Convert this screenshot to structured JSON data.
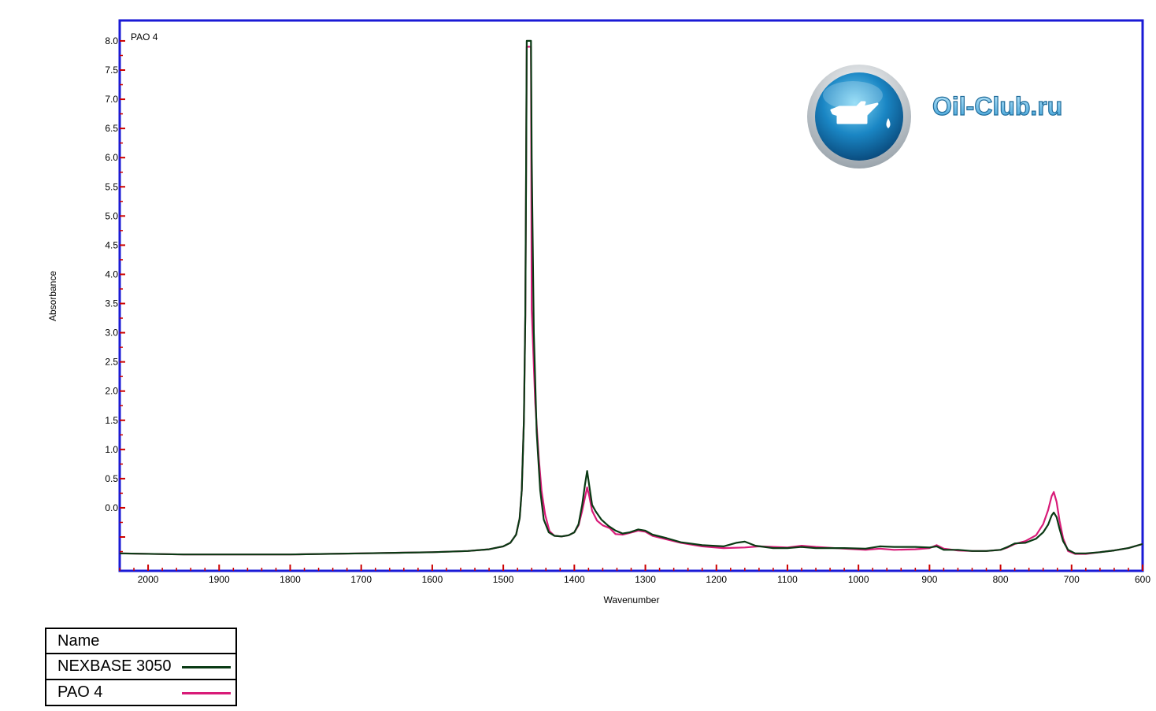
{
  "chart_data": {
    "type": "line",
    "title": "PAO 4",
    "xlabel": "Wavenumber",
    "ylabel": "Absorbance",
    "xlim": [
      2040,
      600
    ],
    "ylim": [
      -1.08,
      8.35
    ],
    "x_ticks": [
      2000,
      1900,
      1800,
      1700,
      1600,
      1500,
      1400,
      1300,
      1200,
      1100,
      1000,
      900,
      800,
      700,
      600
    ],
    "y_ticks": [
      "8.0",
      "7.5",
      "7.0",
      "6.5",
      "6.0",
      "5.5",
      "5.0",
      "4.5",
      "4.0",
      "3.5",
      "3.0",
      "2.5",
      "2.0",
      "1.5",
      "1.0",
      "0.5",
      "0.0"
    ],
    "grid": false,
    "legend_placement": "bottom-left",
    "series": [
      {
        "name": "NEXBASE 3050",
        "color": "#0a3a14",
        "points": [
          [
            2040,
            -0.78
          ],
          [
            1950,
            -0.8
          ],
          [
            1800,
            -0.8
          ],
          [
            1700,
            -0.78
          ],
          [
            1600,
            -0.76
          ],
          [
            1550,
            -0.74
          ],
          [
            1520,
            -0.71
          ],
          [
            1500,
            -0.66
          ],
          [
            1490,
            -0.6
          ],
          [
            1482,
            -0.46
          ],
          [
            1477,
            -0.18
          ],
          [
            1474,
            0.3
          ],
          [
            1471,
            1.5
          ],
          [
            1469,
            3.3
          ],
          [
            1468,
            5.5
          ],
          [
            1467,
            8.0
          ],
          [
            1461,
            8.0
          ],
          [
            1460,
            6.0
          ],
          [
            1457,
            3.0
          ],
          [
            1453,
            1.3
          ],
          [
            1448,
            0.3
          ],
          [
            1443,
            -0.2
          ],
          [
            1436,
            -0.42
          ],
          [
            1428,
            -0.48
          ],
          [
            1418,
            -0.49
          ],
          [
            1408,
            -0.47
          ],
          [
            1400,
            -0.42
          ],
          [
            1394,
            -0.28
          ],
          [
            1389,
            0.05
          ],
          [
            1385,
            0.4
          ],
          [
            1382,
            0.63
          ],
          [
            1379,
            0.38
          ],
          [
            1375,
            0.05
          ],
          [
            1370,
            -0.06
          ],
          [
            1362,
            -0.2
          ],
          [
            1352,
            -0.31
          ],
          [
            1342,
            -0.39
          ],
          [
            1332,
            -0.44
          ],
          [
            1322,
            -0.42
          ],
          [
            1310,
            -0.37
          ],
          [
            1300,
            -0.39
          ],
          [
            1290,
            -0.46
          ],
          [
            1270,
            -0.52
          ],
          [
            1250,
            -0.59
          ],
          [
            1220,
            -0.64
          ],
          [
            1190,
            -0.66
          ],
          [
            1172,
            -0.6
          ],
          [
            1160,
            -0.58
          ],
          [
            1145,
            -0.65
          ],
          [
            1120,
            -0.69
          ],
          [
            1100,
            -0.69
          ],
          [
            1080,
            -0.67
          ],
          [
            1060,
            -0.69
          ],
          [
            1020,
            -0.69
          ],
          [
            990,
            -0.7
          ],
          [
            970,
            -0.66
          ],
          [
            950,
            -0.67
          ],
          [
            920,
            -0.67
          ],
          [
            900,
            -0.68
          ],
          [
            890,
            -0.66
          ],
          [
            880,
            -0.72
          ],
          [
            860,
            -0.72
          ],
          [
            840,
            -0.74
          ],
          [
            820,
            -0.74
          ],
          [
            800,
            -0.72
          ],
          [
            790,
            -0.67
          ],
          [
            780,
            -0.61
          ],
          [
            765,
            -0.6
          ],
          [
            750,
            -0.53
          ],
          [
            740,
            -0.42
          ],
          [
            733,
            -0.29
          ],
          [
            728,
            -0.13
          ],
          [
            725,
            -0.08
          ],
          [
            721,
            -0.16
          ],
          [
            717,
            -0.36
          ],
          [
            712,
            -0.57
          ],
          [
            705,
            -0.72
          ],
          [
            695,
            -0.78
          ],
          [
            680,
            -0.78
          ],
          [
            660,
            -0.76
          ],
          [
            640,
            -0.73
          ],
          [
            620,
            -0.69
          ],
          [
            600,
            -0.62
          ]
        ]
      },
      {
        "name": "PAO 4",
        "color": "#d81b78",
        "points": [
          [
            2040,
            -0.78
          ],
          [
            1950,
            -0.8
          ],
          [
            1800,
            -0.8
          ],
          [
            1700,
            -0.78
          ],
          [
            1600,
            -0.76
          ],
          [
            1550,
            -0.74
          ],
          [
            1520,
            -0.71
          ],
          [
            1500,
            -0.66
          ],
          [
            1490,
            -0.6
          ],
          [
            1482,
            -0.46
          ],
          [
            1477,
            -0.18
          ],
          [
            1474,
            0.3
          ],
          [
            1471,
            1.5
          ],
          [
            1469,
            3.3
          ],
          [
            1468,
            5.5
          ],
          [
            1467,
            7.9
          ],
          [
            1461,
            7.9
          ],
          [
            1460,
            3.4
          ],
          [
            1455,
            1.8
          ],
          [
            1450,
            0.85
          ],
          [
            1446,
            0.28
          ],
          [
            1441,
            -0.12
          ],
          [
            1435,
            -0.4
          ],
          [
            1428,
            -0.48
          ],
          [
            1418,
            -0.49
          ],
          [
            1408,
            -0.47
          ],
          [
            1400,
            -0.42
          ],
          [
            1394,
            -0.3
          ],
          [
            1389,
            -0.05
          ],
          [
            1385,
            0.18
          ],
          [
            1382,
            0.35
          ],
          [
            1379,
            0.2
          ],
          [
            1375,
            -0.05
          ],
          [
            1368,
            -0.22
          ],
          [
            1360,
            -0.3
          ],
          [
            1350,
            -0.35
          ],
          [
            1342,
            -0.45
          ],
          [
            1332,
            -0.46
          ],
          [
            1322,
            -0.43
          ],
          [
            1310,
            -0.39
          ],
          [
            1300,
            -0.41
          ],
          [
            1290,
            -0.48
          ],
          [
            1270,
            -0.54
          ],
          [
            1250,
            -0.6
          ],
          [
            1220,
            -0.66
          ],
          [
            1190,
            -0.69
          ],
          [
            1160,
            -0.68
          ],
          [
            1140,
            -0.66
          ],
          [
            1120,
            -0.67
          ],
          [
            1100,
            -0.68
          ],
          [
            1080,
            -0.65
          ],
          [
            1060,
            -0.67
          ],
          [
            1020,
            -0.7
          ],
          [
            990,
            -0.72
          ],
          [
            970,
            -0.7
          ],
          [
            950,
            -0.72
          ],
          [
            920,
            -0.71
          ],
          [
            900,
            -0.69
          ],
          [
            890,
            -0.64
          ],
          [
            880,
            -0.7
          ],
          [
            860,
            -0.73
          ],
          [
            840,
            -0.74
          ],
          [
            820,
            -0.74
          ],
          [
            800,
            -0.72
          ],
          [
            790,
            -0.68
          ],
          [
            780,
            -0.62
          ],
          [
            765,
            -0.57
          ],
          [
            750,
            -0.47
          ],
          [
            740,
            -0.28
          ],
          [
            733,
            -0.04
          ],
          [
            728,
            0.2
          ],
          [
            725,
            0.27
          ],
          [
            721,
            0.1
          ],
          [
            717,
            -0.22
          ],
          [
            712,
            -0.52
          ],
          [
            705,
            -0.74
          ],
          [
            695,
            -0.79
          ],
          [
            680,
            -0.79
          ],
          [
            660,
            -0.76
          ],
          [
            640,
            -0.73
          ],
          [
            620,
            -0.69
          ],
          [
            600,
            -0.62
          ]
        ]
      }
    ]
  },
  "legend": {
    "header": "Name",
    "items": [
      {
        "label": "NEXBASE 3050",
        "color": "#0a3a14"
      },
      {
        "label": "PAO 4",
        "color": "#d81b78"
      }
    ]
  },
  "watermark": {
    "text": "Oil-Club.ru",
    "icon": "oil-can-icon"
  },
  "colors": {
    "frame": "#1a1ad6",
    "tick": "#cc0000"
  }
}
